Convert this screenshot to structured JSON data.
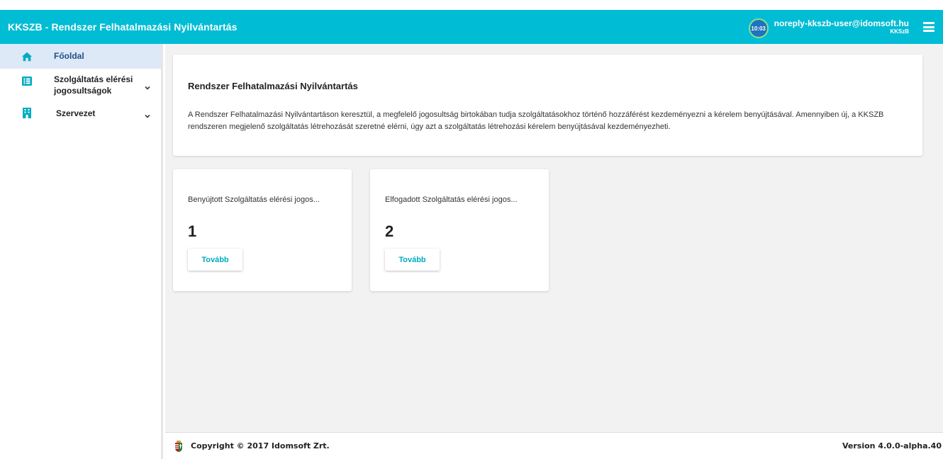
{
  "header": {
    "title": "KKSZB - Rendszer Felhatalmazási Nyilvántartás",
    "timer": "10:03",
    "user_email": "noreply-kkszb-user@idomsoft.hu",
    "user_org": "KKSzB",
    "menu_icon": "hamburger-menu-icon"
  },
  "sidebar": {
    "items": [
      {
        "label": "Főoldal",
        "icon": "home-icon",
        "active": true
      },
      {
        "label": "Szolgáltatás elérési jogosultságok",
        "icon": "list-icon",
        "expandable": true
      },
      {
        "label": "Szervezet",
        "icon": "building-icon",
        "expandable": true
      }
    ]
  },
  "intro": {
    "title": "Rendszer Felhatalmazási Nyilvántartás",
    "text": "A Rendszer Felhatalmazási Nyilvántartáson keresztül, a megfelelő jogosultság birtokában tudja szolgáltatásokhoz történő hozzáférést kezdeményezni a kérelem benyújtásával. Amennyiben új, a KKSZB rendszeren megjelenő szolgáltatás létrehozását szeretné elérni, úgy azt a szolgáltatás létrehozási kérelem benyújtásával kezdeményezheti."
  },
  "stats": [
    {
      "label": "Benyújtott Szolgáltatás elérési jogos...",
      "value": "1",
      "button": "Tovább"
    },
    {
      "label": "Elfogadott Szolgáltatás elérési jogos...",
      "value": "2",
      "button": "Tovább"
    }
  ],
  "footer": {
    "copyright": "Copyright © 2017 Idomsoft Zrt.",
    "version": "Version 4.0.0-alpha.40"
  },
  "colors": {
    "header_bg": "#00bcd4",
    "accent": "#00acc1",
    "active_nav_bg": "#dde9f6",
    "content_bg": "#f2f2f2"
  }
}
